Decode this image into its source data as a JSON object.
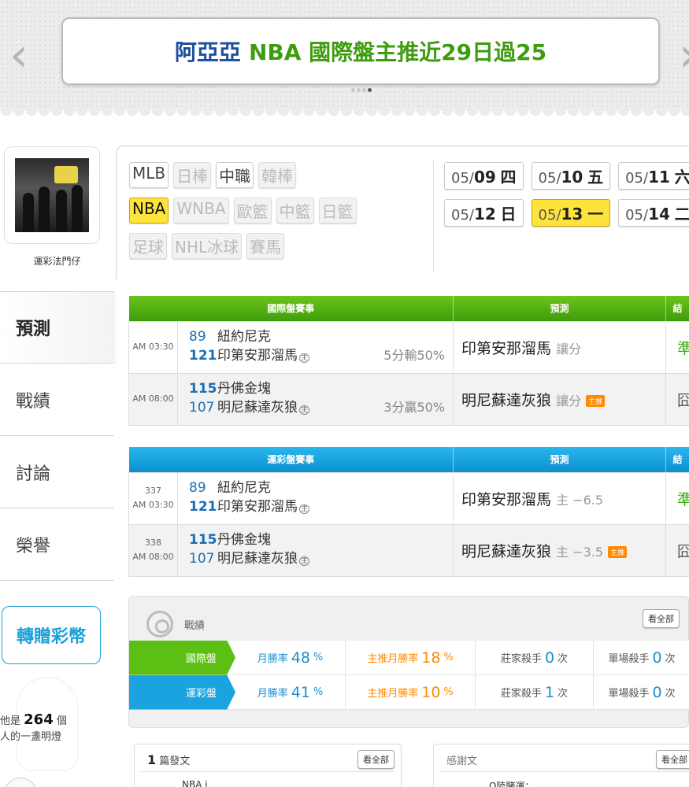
{
  "banner": {
    "title_name": "阿亞亞",
    "title_rest": "NBA 國際盤主推近29日過25",
    "prev_arrow": "‹",
    "next_arrow": "›"
  },
  "sidebar": {
    "username": "運彩法門仔",
    "menu": [
      {
        "label": "預測",
        "active": true
      },
      {
        "label": "戰績",
        "active": false
      },
      {
        "label": "討論",
        "active": false
      },
      {
        "label": "榮譽",
        "active": false
      }
    ],
    "gift_button": "轉贈彩幣",
    "lamp_prefix": "他是",
    "lamp_count": "264",
    "lamp_unit": "個",
    "lamp_suffix": "人的一盞明燈"
  },
  "leagues": {
    "rows": [
      [
        {
          "label": "MLB",
          "state": "normal"
        },
        {
          "label": "日棒",
          "state": "dim"
        },
        {
          "label": "中職",
          "state": "normal"
        },
        {
          "label": "韓棒",
          "state": "dim"
        }
      ],
      [
        {
          "label": "NBA",
          "state": "selected"
        },
        {
          "label": "WNBA",
          "state": "dim"
        },
        {
          "label": "歐籃",
          "state": "dim"
        },
        {
          "label": "中籃",
          "state": "dim"
        },
        {
          "label": "日籃",
          "state": "dim"
        }
      ],
      [
        {
          "label": "足球",
          "state": "dim"
        },
        {
          "label": "NHL冰球",
          "state": "dim"
        },
        {
          "label": "賽馬",
          "state": "dim"
        }
      ]
    ]
  },
  "dates": {
    "rows": [
      [
        {
          "md_prefix": "05/",
          "day": "09",
          "wd": "四",
          "selected": false
        },
        {
          "md_prefix": "05/",
          "day": "10",
          "wd": "五",
          "selected": false
        },
        {
          "md_prefix": "05/",
          "day": "11",
          "wd": "六",
          "selected": false
        }
      ],
      [
        {
          "md_prefix": "05/",
          "day": "12",
          "wd": "日",
          "selected": false
        },
        {
          "md_prefix": "05/",
          "day": "13",
          "wd": "一",
          "selected": true
        },
        {
          "md_prefix": "05/",
          "day": "14",
          "wd": "二",
          "selected": false
        }
      ]
    ]
  },
  "intl_table": {
    "headers": [
      "國際盤賽事",
      "預測",
      "結"
    ],
    "rows": [
      {
        "time": "AM 03:30",
        "away_no": "89",
        "away": "紐約尼克",
        "home_no": "121",
        "home": "印第安那溜馬",
        "home_mark": "主",
        "handicap": "5分輸50%",
        "pred_team": "印第安那溜馬",
        "pred_note": "讓分",
        "badge": "",
        "result": "準",
        "result_type": "win"
      },
      {
        "time": "AM 08:00",
        "away_no": "115",
        "away": "丹佛金塊",
        "home_no": "107",
        "home": "明尼蘇達灰狼",
        "home_mark": "主",
        "handicap": "3分贏50%",
        "pred_team": "明尼蘇達灰狼",
        "pred_note": "讓分",
        "badge": "主推",
        "result": "囧",
        "result_type": "lose"
      }
    ]
  },
  "local_table": {
    "headers": [
      "運彩盤賽事",
      "預測",
      "結"
    ],
    "rows": [
      {
        "code": "337",
        "time": "AM 03:30",
        "away_no": "89",
        "away": "紐約尼克",
        "home_no": "121",
        "home": "印第安那溜馬",
        "home_mark": "主",
        "pred_team": "印第安那溜馬",
        "pred_note": "主 −6.5",
        "badge": "",
        "result": "準",
        "result_type": "win"
      },
      {
        "code": "338",
        "time": "AM 08:00",
        "away_no": "115",
        "away": "丹佛金塊",
        "home_no": "107",
        "home": "明尼蘇達灰狼",
        "home_mark": "主",
        "pred_team": "明尼蘇達灰狼",
        "pred_note": "主 −3.5",
        "badge": "主推",
        "result": "囧",
        "result_type": "lose"
      }
    ]
  },
  "record": {
    "title": "戰績",
    "view_all": "看全部",
    "rows": [
      {
        "label": "國際盤",
        "color": "#5bbf14",
        "month_label": "月勝率",
        "month_value": "48",
        "month_unit": "%",
        "main_label": "主推月勝率",
        "main_value": "18",
        "main_unit": "%",
        "killer_label": "莊家殺手",
        "killer_value": "0",
        "killer_unit": "次",
        "single_label": "單場殺手",
        "single_value": "0",
        "single_unit": "次"
      },
      {
        "label": "運彩盤",
        "color": "#1ba3e0",
        "month_label": "月勝率",
        "month_value": "41",
        "month_unit": "%",
        "main_label": "主推月勝率",
        "main_value": "10",
        "main_unit": "%",
        "killer_label": "莊家殺手",
        "killer_value": "1",
        "killer_unit": "次",
        "single_label": "單場殺手",
        "single_value": "0",
        "single_unit": "次"
      }
    ]
  },
  "posts_box": {
    "count": "1",
    "label": "篇發文",
    "view_all": "看全部",
    "first_item": "NBA i"
  },
  "thanks_box": {
    "label": "感謝文",
    "view_all": "看全部",
    "first_item": "Q陸賭運："
  }
}
